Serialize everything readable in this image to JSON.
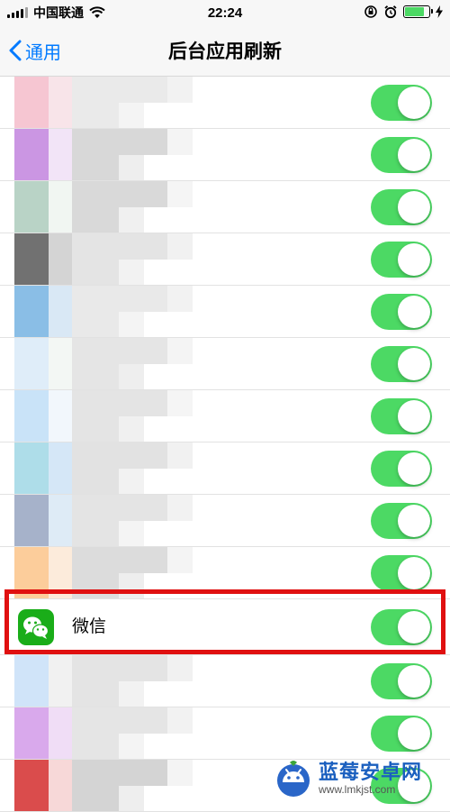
{
  "status_bar": {
    "carrier": "中国联通",
    "time": "22:24",
    "battery_level": 0.85
  },
  "nav": {
    "back_label": "通用",
    "title": "后台应用刷新"
  },
  "apps": [
    {
      "name": "",
      "enabled": true,
      "blurred": true,
      "tones": [
        "#f0a0b4",
        "#f6dde3",
        "#dcdcdc"
      ]
    },
    {
      "name": "",
      "enabled": true,
      "blurred": true,
      "tones": [
        "#c58be0",
        "#ecd8f4",
        "#d4d4d4"
      ]
    },
    {
      "name": "",
      "enabled": true,
      "blurred": true,
      "tones": [
        "#a8c8b8",
        "#e8f0ea",
        "#d0d0d0"
      ]
    },
    {
      "name": "",
      "enabled": true,
      "blurred": true,
      "tones": [
        "#353535",
        "#cfcfcf",
        "#d8d8d8"
      ]
    },
    {
      "name": "",
      "enabled": true,
      "blurred": true,
      "tones": [
        "#3c92d6",
        "#cfe2f2",
        "#dadada"
      ]
    },
    {
      "name": "",
      "enabled": true,
      "blurred": true,
      "tones": [
        "#dcebf8",
        "#eef4f0",
        "#e2e2e2"
      ]
    },
    {
      "name": "",
      "enabled": true,
      "blurred": true,
      "tones": [
        "#bcdcf6",
        "#eaf2fa",
        "#dddddd"
      ]
    },
    {
      "name": "",
      "enabled": true,
      "blurred": true,
      "tones": [
        "#8ccfe0",
        "#d0e4f6",
        "#d6d6d6"
      ]
    },
    {
      "name": "",
      "enabled": true,
      "blurred": true,
      "tones": [
        "#6a7ea6",
        "#d6e6f4",
        "#d2d2d2"
      ]
    },
    {
      "name": "",
      "enabled": true,
      "blurred": true,
      "tones": [
        "#fcc890",
        "#fbe2cc",
        "#d8d8d8"
      ]
    },
    {
      "name": "微信",
      "enabled": true,
      "blurred": false,
      "icon": "wechat-icon",
      "icon_color": "#1aad19"
    },
    {
      "name": "",
      "enabled": true,
      "blurred": true,
      "tones": [
        "#bcd8f6",
        "#f0f0f0",
        "#d8d8d8"
      ]
    },
    {
      "name": "",
      "enabled": true,
      "blurred": true,
      "tones": [
        "#c070e0",
        "#ecd4f4",
        "#d4d4d4"
      ]
    },
    {
      "name": "",
      "enabled": true,
      "blurred": true,
      "tones": [
        "#d63838",
        "#f4c8c8",
        "#cfcfcf"
      ]
    }
  ],
  "colors": {
    "toggle_on": "#4cd964",
    "ios_blue": "#007aff",
    "highlight": "#e01010"
  },
  "watermark": {
    "title": "蓝莓安卓网",
    "url": "www.lmkjst.com",
    "icon": "android-blueberry-logo"
  }
}
